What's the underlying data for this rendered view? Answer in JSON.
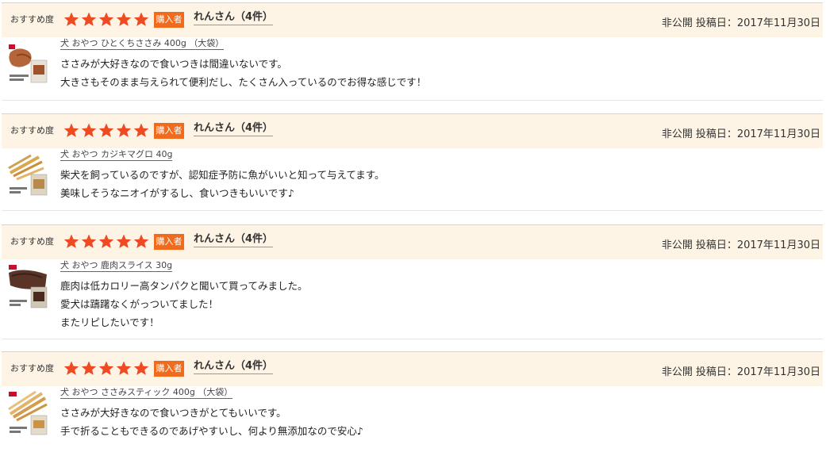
{
  "reviews": [
    {
      "rec_label": "おすすめ度",
      "stars": 5,
      "badge": "購入者",
      "reviewer": "れんさん（4件）",
      "privacy": "非公開",
      "posted": "投稿日：2017年11月30日",
      "product": "犬 おやつ ひとくちささみ 400g （大袋）",
      "thumb_icon": "chicken-jerky-product-image",
      "lines": [
        "ささみが大好きなので食いつきは間違いないです。",
        "大きさもそのまま与えられて便利だし、たくさん入っているのでお得な感じです！"
      ]
    },
    {
      "rec_label": "おすすめ度",
      "stars": 5,
      "badge": "購入者",
      "reviewer": "れんさん（4件）",
      "privacy": "非公開",
      "posted": "投稿日：2017年11月30日",
      "product": "犬 おやつ カジキマグロ 40g",
      "thumb_icon": "swordfish-sticks-product-image",
      "lines": [
        "柴犬を飼っているのですが、認知症予防に魚がいいと知って与えてます。",
        "美味しそうなニオイがするし、食いつきもいいです♪"
      ]
    },
    {
      "rec_label": "おすすめ度",
      "stars": 5,
      "badge": "購入者",
      "reviewer": "れんさん（4件）",
      "privacy": "非公開",
      "posted": "投稿日：2017年11月30日",
      "product": "犬 おやつ 鹿肉スライス 30g",
      "thumb_icon": "venison-slice-product-image",
      "lines": [
        "鹿肉は低カロリー高タンパクと聞いて買ってみました。",
        "愛犬は躊躇なくがっついてました！",
        "またリピしたいです！"
      ]
    },
    {
      "rec_label": "おすすめ度",
      "stars": 5,
      "badge": "購入者",
      "reviewer": "れんさん（4件）",
      "privacy": "非公開",
      "posted": "投稿日：2017年11月30日",
      "product": "犬 おやつ ささみスティック 400g （大袋）",
      "thumb_icon": "chicken-stick-product-image",
      "lines": [
        "ささみが大好きなので食いつきがとてもいいです。",
        "手で折ることもできるのであげやすいし、何より無添加なので安心♪"
      ]
    }
  ],
  "colors": {
    "star": "#ef4b23",
    "badge": "#f26b1c",
    "header_bg": "#fdf4e5",
    "header_border": "#f0d390"
  }
}
